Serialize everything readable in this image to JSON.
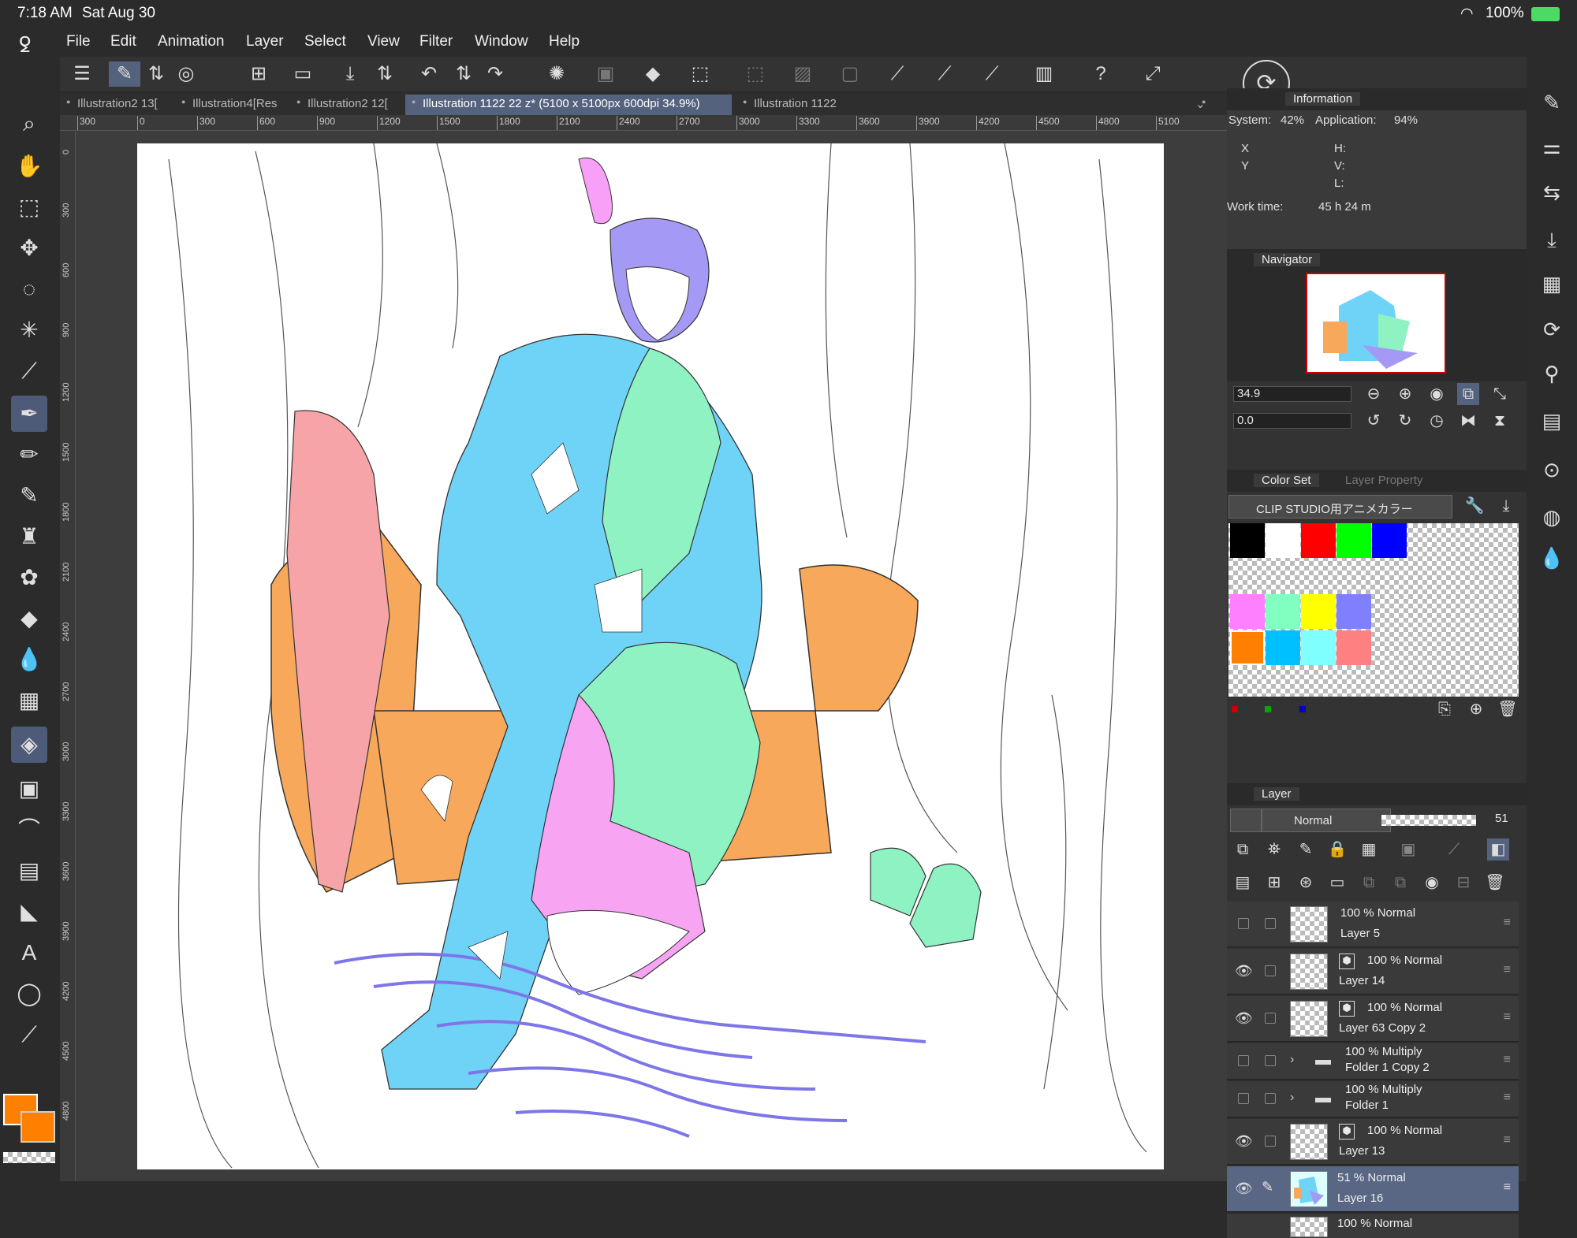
{
  "status": {
    "time": "7:18 AM",
    "date": "Sat Aug 30",
    "battery": "100%"
  },
  "menu": [
    "File",
    "Edit",
    "Animation",
    "Layer",
    "Select",
    "View",
    "Filter",
    "Window",
    "Help"
  ],
  "tabs": [
    "Illustration2 13[",
    "Illustration4[Res",
    "Illustration2 12[",
    "Illustration 1122 22 z* (5100 x 5100px 600dpi 34.9%)",
    "Illustration 1122"
  ],
  "ruler_top": [
    "300",
    "0",
    "300",
    "600",
    "900",
    "1200",
    "1500",
    "1800",
    "2100",
    "2400",
    "2700",
    "3000",
    "3300",
    "3600",
    "3900",
    "4200",
    "4500",
    "4800",
    "5100"
  ],
  "ruler_left": [
    "0",
    "300",
    "600",
    "900",
    "1200",
    "1500",
    "1800",
    "2100",
    "2400",
    "2700",
    "3000",
    "3300",
    "3600",
    "3900",
    "4200",
    "4500",
    "4800"
  ],
  "information": {
    "title": "Information",
    "system_label": "System:",
    "system_value": "42%",
    "app_label": "Application:",
    "app_value": "94%",
    "x": "X",
    "y": "Y",
    "h": "H:",
    "v": "V:",
    "l": "L:",
    "worktime_label": "Work time:",
    "worktime_value": "45 h 24 m"
  },
  "navigator": {
    "title": "Navigator",
    "zoom": "34.9",
    "rotation": "0.0"
  },
  "colorset": {
    "tab1": "Color Set",
    "tab2": "Layer Property",
    "set_name": "CLIP STUDIO用アニメカラー",
    "colors": [
      "#000000",
      "#ffffff",
      "#ff0000",
      "#00ff00",
      "#0000ff",
      "#ff80ff",
      "#80ffc0",
      "#ffff00",
      "#8080ff",
      "#ff8000",
      "#00c0ff",
      "#80ffff",
      "#ff8080"
    ]
  },
  "layer_panel": {
    "title": "Layer",
    "blend_mode": "Normal",
    "opacity": "51",
    "layers": [
      {
        "mode": "100 % Normal",
        "name": "Layer 5",
        "visible": false
      },
      {
        "mode": "100 % Normal",
        "name": "Layer 14",
        "visible": true
      },
      {
        "mode": "100 % Normal",
        "name": "Layer 63 Copy 2",
        "visible": true
      },
      {
        "mode": "100 % Multiply",
        "name": "Folder 1 Copy 2",
        "visible": false
      },
      {
        "mode": "100 % Multiply",
        "name": "Folder 1",
        "visible": false
      },
      {
        "mode": "100 % Normal",
        "name": "Layer 13",
        "visible": true
      },
      {
        "mode": "51 % Normal",
        "name": "Layer 16",
        "visible": true
      },
      {
        "mode": "100 % Normal",
        "name": "",
        "visible": false
      }
    ]
  },
  "current_color": "#ff7f00",
  "accent": "#55627e"
}
